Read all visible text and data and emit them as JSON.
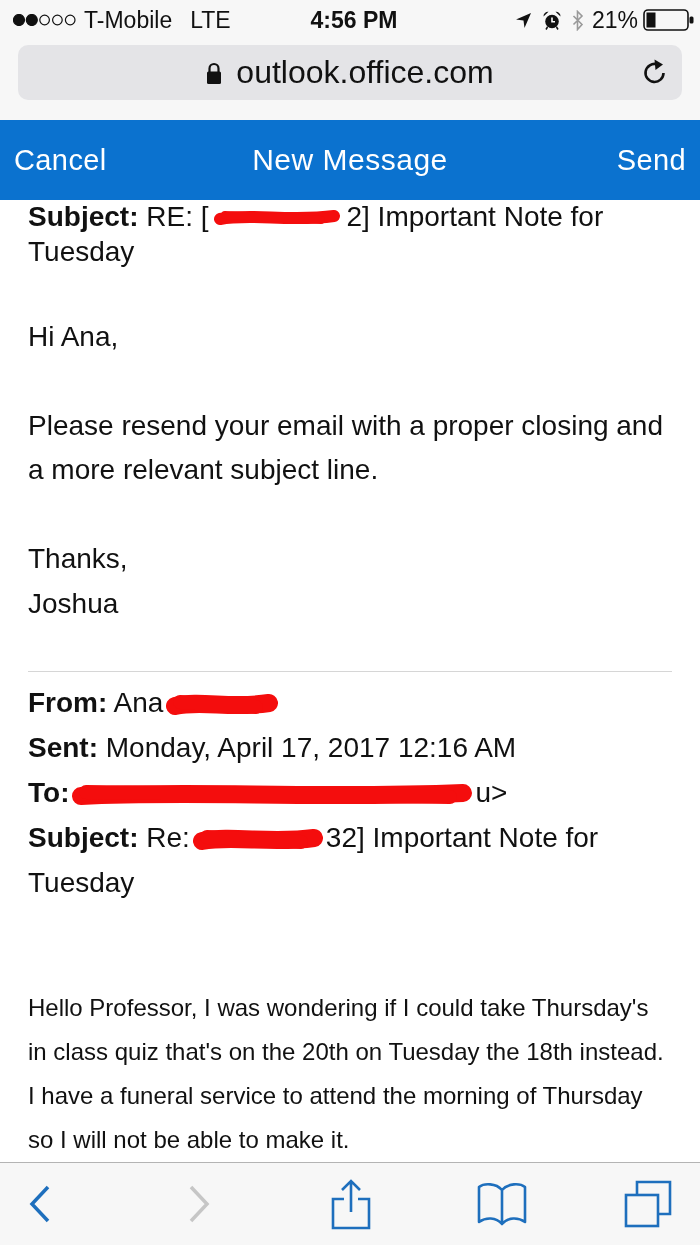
{
  "status_bar": {
    "carrier": "T-Mobile",
    "network": "LTE",
    "time": "4:56 PM",
    "battery": "21%"
  },
  "address_bar": {
    "url": "outlook.office.com"
  },
  "header": {
    "cancel": "Cancel",
    "title": "New Message",
    "send": "Send"
  },
  "reply": {
    "clipped_line": [
      {
        "kind": "text",
        "text": "**Subject:** RE: ["
      },
      {
        "kind": "redaction"
      },
      {
        "kind": "text",
        "text": "2] Important Note for"
      }
    ],
    "paragraphs": [
      [
        "Tuesday"
      ],
      [
        "Hi Ana,"
      ],
      [
        "Please resend your email with a proper closing and a more relevant subject line."
      ],
      [
        "Thanks,",
        "Joshua"
      ]
    ]
  },
  "quoted_header": [
    [
      {
        "kind": "text",
        "text": "**From:** Ana"
      },
      {
        "kind": "redaction"
      }
    ],
    [
      {
        "kind": "text",
        "text": "**Sent:** Monday, April 17, 2017 12:16 AM"
      }
    ],
    [
      {
        "kind": "text",
        "text": "**To:**"
      },
      {
        "kind": "redaction"
      },
      {
        "kind": "text",
        "text": "u>"
      }
    ],
    [
      {
        "kind": "text",
        "text": "**Subject:** Re:"
      },
      {
        "kind": "redaction"
      },
      {
        "kind": "text",
        "text": "32] Important Note for"
      }
    ],
    [
      {
        "kind": "text",
        "text": "Tuesday"
      }
    ]
  ],
  "quoted_body": [
    "Hello Professor, I was wondering if I could take Thursday's",
    "in class quiz that's on the 20th on Tuesday the 18th instead.",
    "I have a funeral service to attend the morning of Thursday",
    "so I will not be able to make it."
  ],
  "toolbar": {
    "buttons": [
      {
        "kind": "back",
        "disabled": false
      },
      {
        "kind": "forward",
        "disabled": true
      },
      {
        "kind": "share",
        "disabled": false
      },
      {
        "kind": "bookmarks",
        "disabled": false
      },
      {
        "kind": "tabs",
        "disabled": false
      }
    ]
  }
}
